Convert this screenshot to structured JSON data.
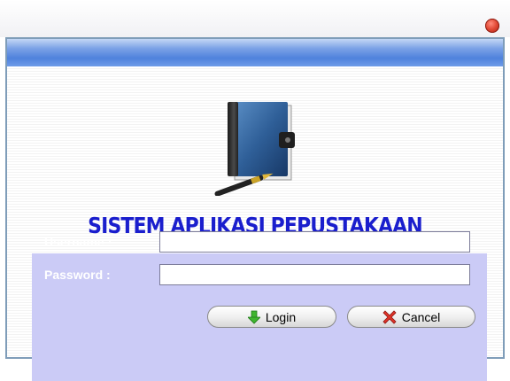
{
  "window": {
    "close_icon": "close-icon",
    "accent_color": "#5a8ae0"
  },
  "app": {
    "title": "SISTEM APLIKASI PEPUSTAKAAN",
    "title_color": "#1a1ecd",
    "logo_icon": "book-with-pen-icon"
  },
  "form": {
    "username_label": "Username :",
    "password_label": "Password :",
    "username_value": "",
    "password_value": "",
    "panel_color": "#cbcbf6"
  },
  "buttons": {
    "login_label": "Login",
    "login_icon": "green-down-arrow-icon",
    "cancel_label": "Cancel",
    "cancel_icon": "red-x-icon"
  }
}
